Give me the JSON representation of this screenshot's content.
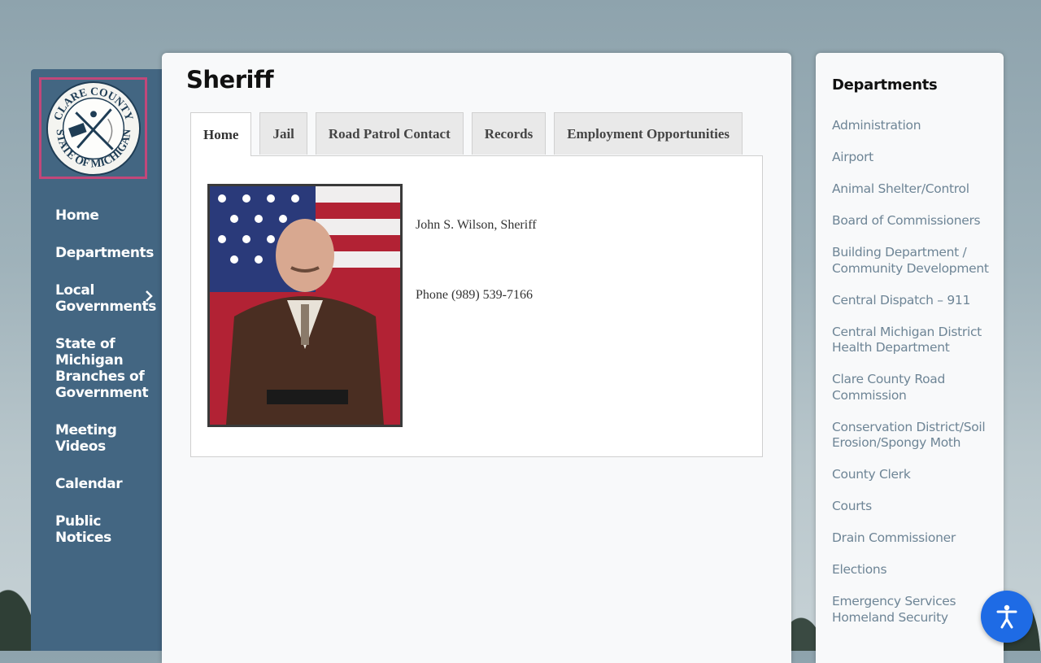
{
  "sidebar": {
    "logo": {
      "top_text": "CLARE COUNTY",
      "bottom_text": "STATE OF MICHIGAN"
    },
    "items": [
      {
        "label": "Home"
      },
      {
        "label": "Departments"
      },
      {
        "label": "Local Governments"
      },
      {
        "label": "State of Michigan Branches of Government"
      },
      {
        "label": "Meeting Videos"
      },
      {
        "label": "Calendar"
      },
      {
        "label": "Public Notices"
      }
    ]
  },
  "main": {
    "title": "Sheriff",
    "tabs": [
      {
        "label": "Home"
      },
      {
        "label": "Jail"
      },
      {
        "label": "Road Patrol Contact"
      },
      {
        "label": "Records"
      },
      {
        "label": "Employment Opportunities"
      }
    ],
    "active_tab": "Home",
    "sheriff_name": "John S. Wilson, Sheriff",
    "phone": "Phone (989) 539-7166"
  },
  "rightbar": {
    "title": "Departments",
    "items": [
      "Administration",
      "Airport",
      "Animal Shelter/Control",
      "Board of Commissioners",
      "Building Department / Community Development",
      "Central Dispatch – 911",
      "Central Michigan District Health Department",
      "Clare County Road Commission",
      "Conservation District/Soil Erosion/Spongy Moth",
      "County Clerk",
      "Courts",
      "Drain Commissioner",
      "Elections",
      "Emergency Services Homeland Security"
    ]
  },
  "colors": {
    "sidebar_bg": "#436682",
    "logo_border": "#c2477a",
    "link": "#6e8596",
    "accessibility_button": "#1e6be5"
  },
  "icons": {
    "submenu": "chevron-right-icon",
    "accessibility": "accessibility-icon"
  }
}
